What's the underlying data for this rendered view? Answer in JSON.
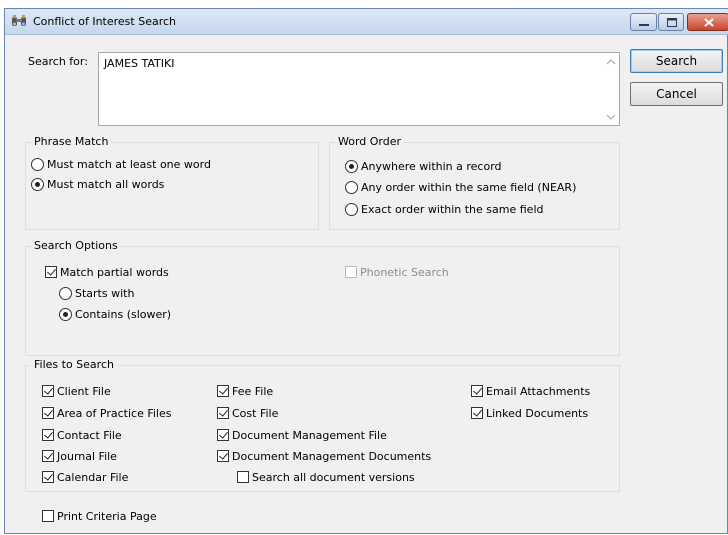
{
  "window": {
    "title": "Conflict of Interest Search",
    "app_icon": "binoculars-icon"
  },
  "search": {
    "label": "Search for:",
    "value": "JAMES TATIKI"
  },
  "buttons": {
    "search": "Search",
    "cancel": "Cancel"
  },
  "phrase_match": {
    "title": "Phrase Match",
    "options": [
      {
        "label": "Must match at least one word",
        "selected": false
      },
      {
        "label": "Must match all words",
        "selected": true
      }
    ]
  },
  "word_order": {
    "title": "Word Order",
    "options": [
      {
        "label": "Anywhere within a record",
        "selected": true
      },
      {
        "label": "Any order within the same field (NEAR)",
        "selected": false
      },
      {
        "label": "Exact order within the same field",
        "selected": false
      }
    ]
  },
  "search_options": {
    "title": "Search Options",
    "match_partial": {
      "label": "Match partial words",
      "checked": true
    },
    "starts_with": {
      "label": "Starts with",
      "selected": false
    },
    "contains": {
      "label": "Contains (slower)",
      "selected": true
    },
    "phonetic": {
      "label": "Phonetic Search",
      "checked": false,
      "enabled": false
    }
  },
  "files_to_search": {
    "title": "Files to Search",
    "items": [
      {
        "label": "Client File",
        "checked": true
      },
      {
        "label": "Area of Practice Files",
        "checked": true
      },
      {
        "label": "Contact File",
        "checked": true
      },
      {
        "label": "Journal File",
        "checked": true
      },
      {
        "label": "Calendar File",
        "checked": true
      },
      {
        "label": "Fee File",
        "checked": true
      },
      {
        "label": "Cost File",
        "checked": true
      },
      {
        "label": "Document Management File",
        "checked": true
      },
      {
        "label": "Document Management Documents",
        "checked": true
      },
      {
        "label": "Search all document versions",
        "checked": false
      },
      {
        "label": "Email Attachments",
        "checked": true
      },
      {
        "label": "Linked Documents",
        "checked": true
      }
    ]
  },
  "print_criteria": {
    "label": "Print Criteria Page",
    "checked": false
  }
}
